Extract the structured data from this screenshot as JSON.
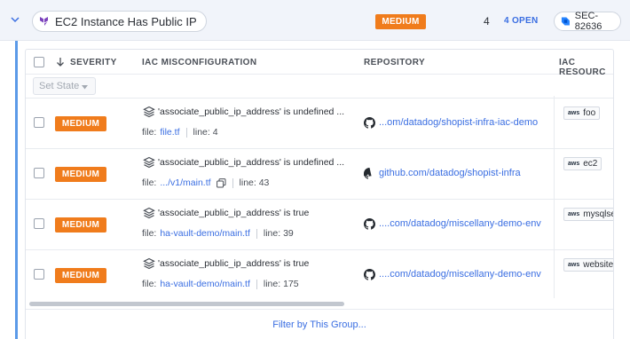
{
  "group": {
    "title": "EC2 Instance Has Public IP",
    "severity": "MEDIUM",
    "count": "4",
    "open_label": "4 OPEN",
    "ticket": "SEC-82636"
  },
  "table": {
    "columns": {
      "severity": "SEVERITY",
      "misconfiguration": "IAC MISCONFIGURATION",
      "repository": "REPOSITORY",
      "resource": "IAC RESOURC"
    },
    "set_state": {
      "label": "Set State"
    },
    "rows": [
      {
        "severity": "MEDIUM",
        "title": "'associate_public_ip_address' is undefined ...",
        "file_label": "file:",
        "file": "file.tf",
        "line_label": "line: 4",
        "repo": "...om/datadog/shopist-infra-iac-demo",
        "resource": "foo"
      },
      {
        "severity": "MEDIUM",
        "title": "'associate_public_ip_address' is undefined ...",
        "file_label": "file:",
        "file": ".../v1/main.tf",
        "line_label": "line: 43",
        "repo": "github.com/datadog/shopist-infra",
        "resource": "ec2"
      },
      {
        "severity": "MEDIUM",
        "title": "'associate_public_ip_address' is true",
        "file_label": "file:",
        "file": "ha-vault-demo/main.tf",
        "line_label": "line: 39",
        "repo": "....com/datadog/miscellany-demo-env",
        "resource": "mysqlse"
      },
      {
        "severity": "MEDIUM",
        "title": "'associate_public_ip_address' is true",
        "file_label": "file:",
        "file": "ha-vault-demo/main.tf",
        "line_label": "line: 175",
        "repo": "....com/datadog/miscellany-demo-env",
        "resource": "website"
      }
    ],
    "aws_label": "aws"
  },
  "footer": {
    "filter_label": "Filter by This Group..."
  },
  "colors": {
    "accent": "#3a6ee2",
    "severity_medium": "#f07c1c",
    "group_bar": "#5b9ae8",
    "terraform": "#7b42bc",
    "jira": "#2684ff"
  },
  "icons": [
    "chevron-down-icon",
    "terraform-icon",
    "jira-icon",
    "sort-arrow-icon",
    "layers-icon",
    "copy-icon",
    "github-icon",
    "aws-icon"
  ]
}
